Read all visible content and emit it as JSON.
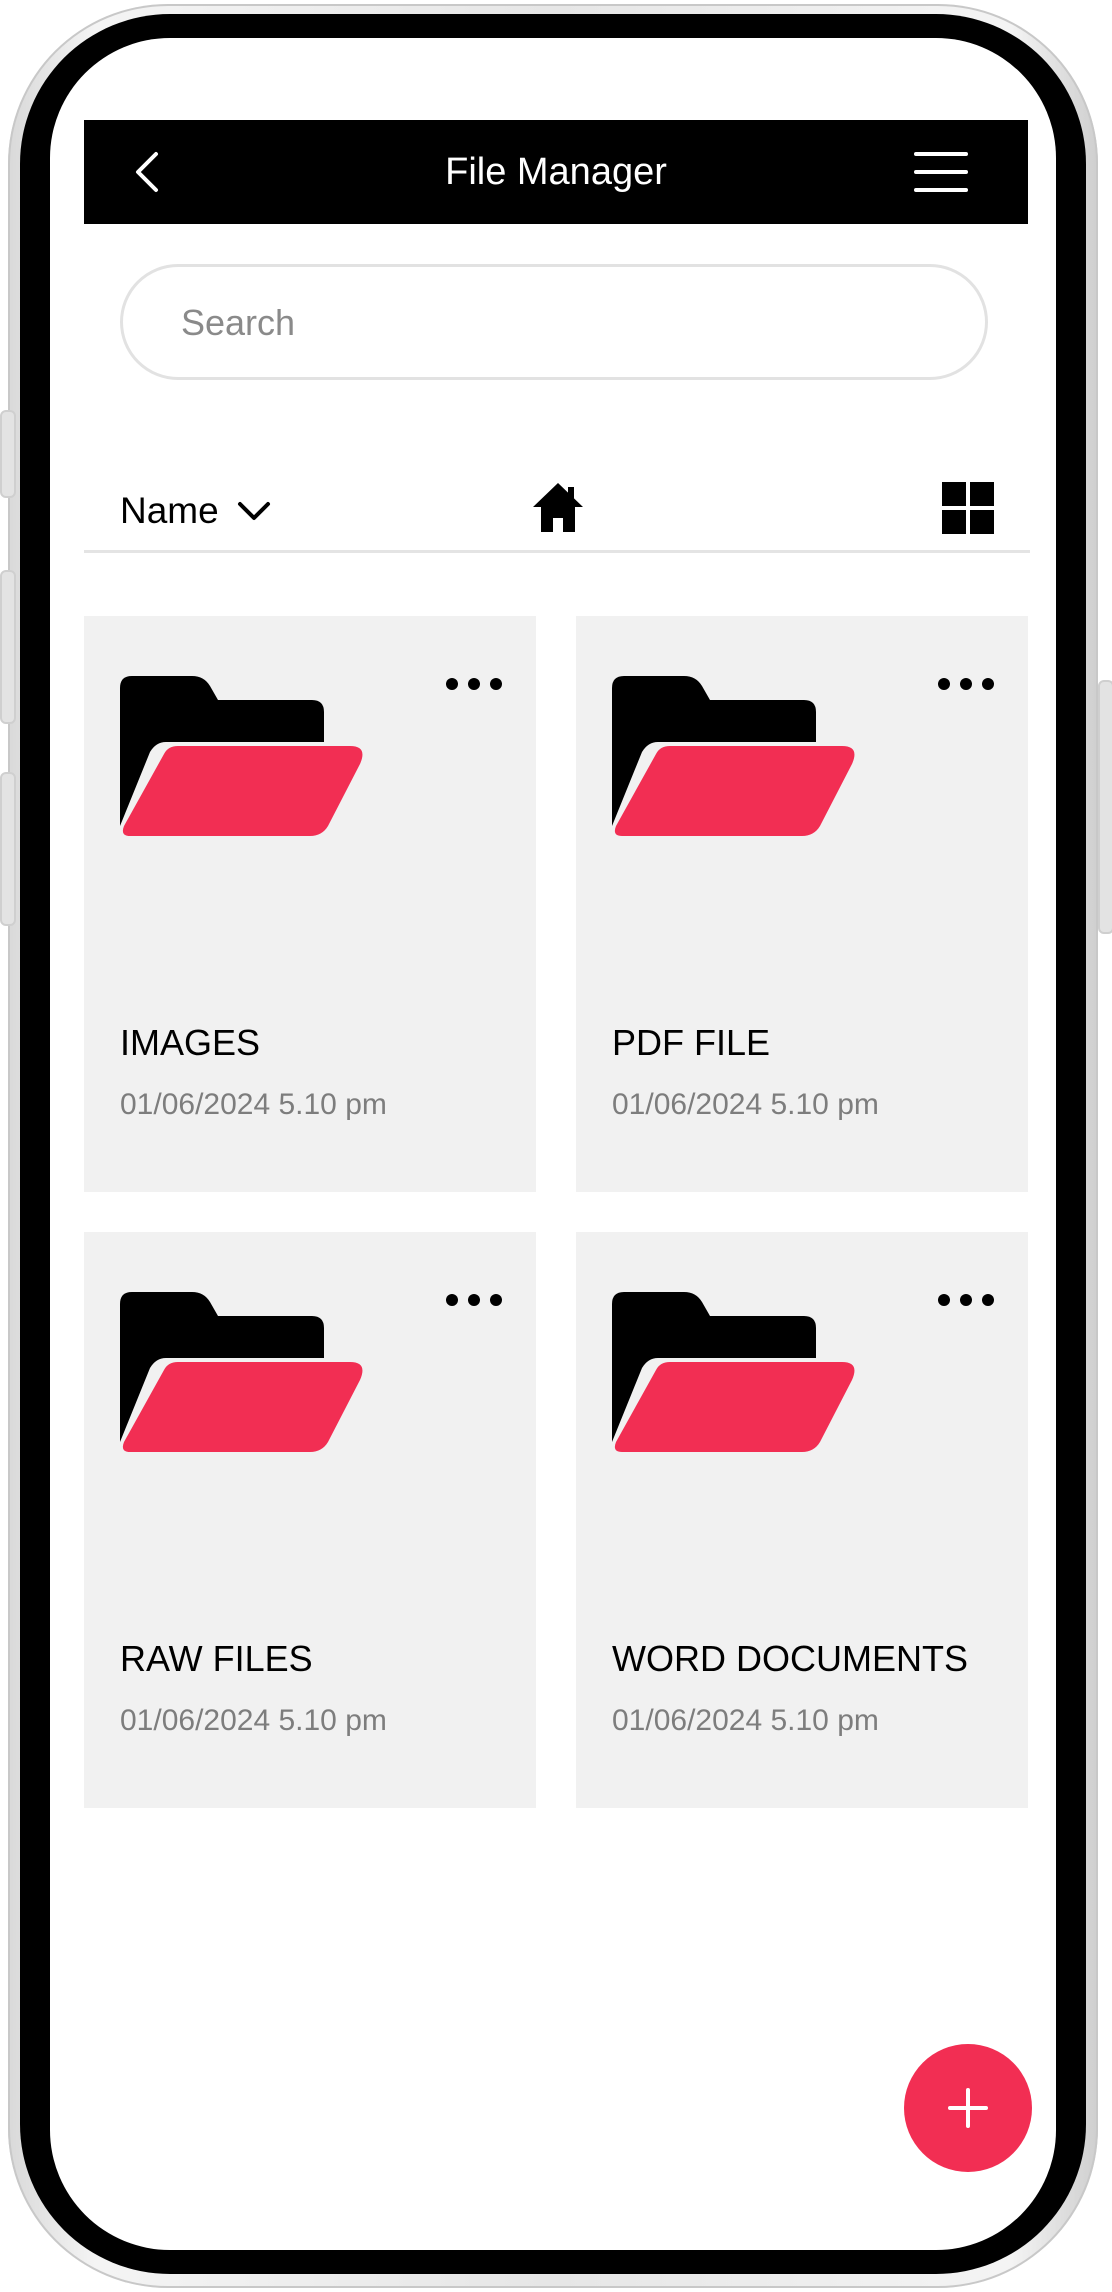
{
  "header": {
    "title": "File Manager"
  },
  "search": {
    "placeholder": "Search"
  },
  "toolbar": {
    "sort_label": "Name"
  },
  "folders": [
    {
      "name": "IMAGES",
      "date": "01/06/2024 5.10 pm"
    },
    {
      "name": "PDF FILE",
      "date": "01/06/2024 5.10 pm"
    },
    {
      "name": "RAW FILES",
      "date": "01/06/2024 5.10 pm"
    },
    {
      "name": "WORD DOCUMENTS",
      "date": "01/06/2024 5.10 pm"
    }
  ],
  "icons": {
    "back": "chevron-left-icon",
    "menu": "hamburger-menu-icon",
    "sort": "chevron-down-icon",
    "home": "home-icon",
    "view": "grid-view-icon",
    "folder": "folder-open-icon",
    "more": "more-horizontal-icon",
    "fab": "plus-icon"
  },
  "colors": {
    "accent": "#f22e53",
    "header_bg": "#000000",
    "card_bg": "#f1f1f1"
  }
}
